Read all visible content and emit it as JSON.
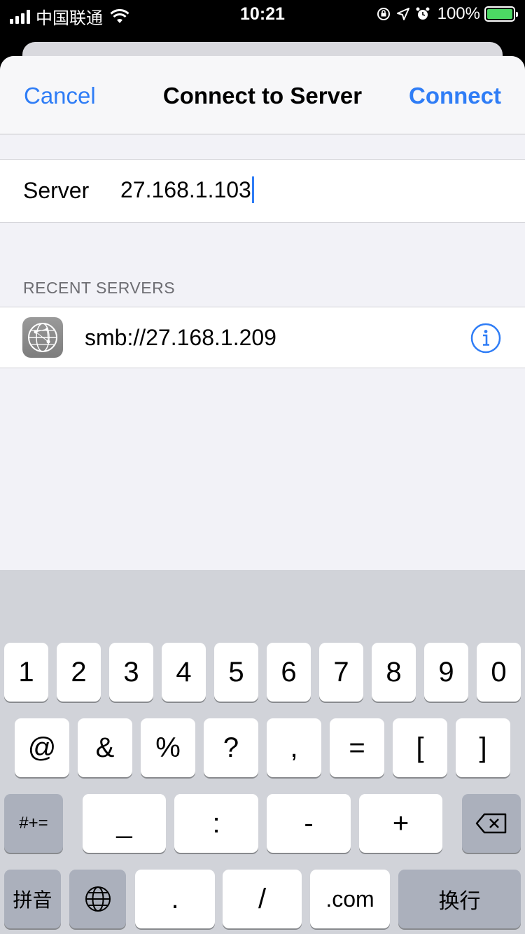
{
  "status_bar": {
    "carrier": "中国联通",
    "time": "10:21",
    "battery": "100%",
    "icons": [
      "signal-icon",
      "wifi-icon",
      "orientation-lock-icon",
      "location-icon",
      "alarm-icon",
      "battery-charging-icon"
    ]
  },
  "nav": {
    "cancel": "Cancel",
    "title": "Connect to Server",
    "connect": "Connect"
  },
  "server": {
    "label": "Server",
    "value": "27.168.1.103"
  },
  "recent": {
    "header": "RECENT SERVERS",
    "items": [
      {
        "address": "smb://27.168.1.209"
      }
    ]
  },
  "keyboard": {
    "row1": [
      "1",
      "2",
      "3",
      "4",
      "5",
      "6",
      "7",
      "8",
      "9",
      "0"
    ],
    "row2": [
      "@",
      "&",
      "%",
      "?",
      ",",
      "=",
      "[",
      "]"
    ],
    "row3": [
      "#+=",
      "_",
      ":",
      "-",
      "+"
    ],
    "row4": [
      "拼音",
      ".",
      "/",
      ".com",
      "换行"
    ],
    "icons": [
      "backspace-icon",
      "globe-icon"
    ]
  },
  "colors": {
    "accent": "#2f7df6",
    "background": "#f2f2f7",
    "keyboard_bg": "#d1d3d9",
    "function_key": "#abb0bc"
  }
}
